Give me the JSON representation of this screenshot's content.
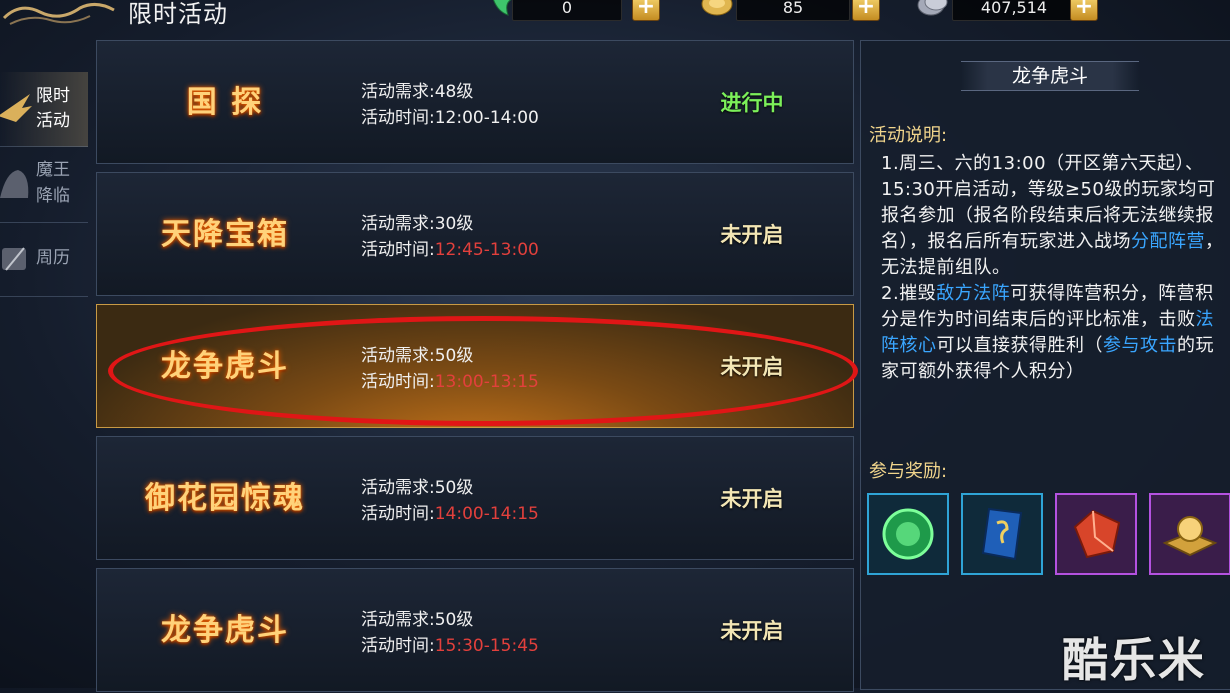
{
  "header": {
    "title": "限时活动"
  },
  "resources": [
    {
      "name": "jade-icon",
      "value": "0"
    },
    {
      "name": "gold-coin-icon",
      "value": "85"
    },
    {
      "name": "silver-coin-icon",
      "value": "407,514"
    }
  ],
  "sidebar": {
    "items": [
      {
        "label": "限时活动",
        "line1": "限时",
        "line2": "活动",
        "active": true
      },
      {
        "label": "魔王降临",
        "line1": "魔王",
        "line2": "降临",
        "active": false
      },
      {
        "label": "周历",
        "line1": "周历",
        "line2": "",
        "active": false
      }
    ]
  },
  "activities": [
    {
      "name": "国 探",
      "req_label": "活动需求:",
      "req_value": "48级",
      "time_label": "活动时间:",
      "time_value": "12:00-14:00",
      "time_color": "white",
      "status": "进行中"
    },
    {
      "name": "天降宝箱",
      "req_label": "活动需求:",
      "req_value": "30级",
      "time_label": "活动时间:",
      "time_value": "12:45-13:00",
      "time_color": "red",
      "status": "未开启"
    },
    {
      "name": "龙争虎斗",
      "req_label": "活动需求:",
      "req_value": "50级",
      "time_label": "活动时间:",
      "time_value": "13:00-13:15",
      "time_color": "red",
      "status": "未开启"
    },
    {
      "name": "御花园惊魂",
      "req_label": "活动需求:",
      "req_value": "50级",
      "time_label": "活动时间:",
      "time_value": "14:00-14:15",
      "time_color": "red",
      "status": "未开启"
    },
    {
      "name": "龙争虎斗",
      "req_label": "活动需求:",
      "req_value": "50级",
      "time_label": "活动时间:",
      "time_value": "15:30-15:45",
      "time_color": "red",
      "status": "未开启"
    }
  ],
  "detail": {
    "title": "龙争虎斗",
    "desc_heading": "活动说明:",
    "desc_part1": "1.周三、六的13:00（开区第六天起）、15:30开启活动，等级≥50级的玩家均可报名参加（报名阶段结束后将无法继续报名），报名后所有玩家进入战场",
    "desc_link1": "分配阵营",
    "desc_part2": "，无法提前组队。",
    "desc_part3": "2.摧毁",
    "desc_link2": "敌方法阵",
    "desc_part4": "可获得阵营积分，阵营积分是作为时间结束后的评比标准，击败",
    "desc_link3": "法阵核心",
    "desc_part5": "可以直接获得胜利（",
    "desc_link4": "参与攻击",
    "desc_part6": "的玩家可额外获得个人积分）",
    "reward_heading": "参与奖励:",
    "rewards": [
      "green-orb-icon",
      "blue-rune-stone-icon",
      "red-crystal-icon",
      "golden-pearl-icon"
    ]
  },
  "watermark": "酷乐米",
  "colors": {
    "accent_gold": "#ffd27a",
    "link_blue": "#3aa6ff",
    "status_active": "#7cf05a",
    "time_red": "#e2403c",
    "highlight": "#e01616"
  }
}
